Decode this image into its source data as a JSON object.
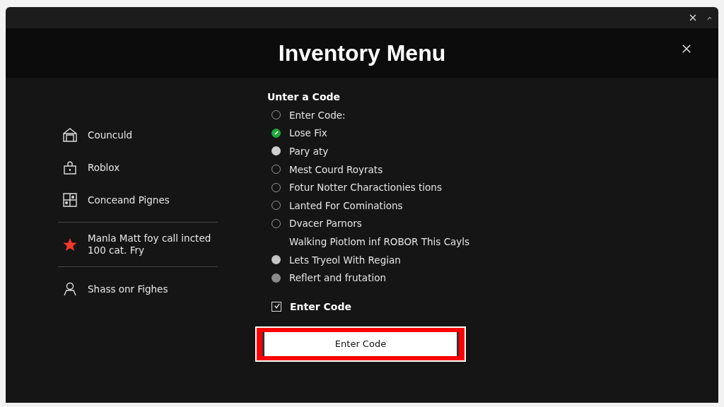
{
  "window": {
    "title": "Inventory Menu"
  },
  "sidebar": {
    "items": [
      {
        "label": "Counculd"
      },
      {
        "label": "Roblox"
      },
      {
        "label": "Conceand Pignes"
      },
      {
        "label": "Manla Matt foy call incted 100 cat. Fry"
      },
      {
        "label": "Shass onr Fighes"
      }
    ]
  },
  "form": {
    "heading": "Unter a Code",
    "options": [
      {
        "label": "Enter Code:",
        "kind": "radio",
        "selected": false
      },
      {
        "label": "Lose Fix",
        "kind": "radio",
        "selected": true
      },
      {
        "label": "Pary aty",
        "kind": "filled",
        "color": "#cfcfcf"
      },
      {
        "label": "Mest Courd Royrats",
        "kind": "radio",
        "selected": false
      },
      {
        "label": "Fotur Notter Charactionies tions",
        "kind": "radio",
        "selected": false
      },
      {
        "label": "Lanted For Cominations",
        "kind": "radio",
        "selected": false
      },
      {
        "label": "Dvacer Parnors",
        "kind": "radio",
        "selected": false
      },
      {
        "label": "Walking Piotlom inf ROBOR This Cayls",
        "kind": "plain"
      },
      {
        "label": "Lets Tryeol With Regian",
        "kind": "filled",
        "color": "#c4c4c4"
      },
      {
        "label": "Reflert and frutation",
        "kind": "filled",
        "color": "#8a8a8a"
      }
    ],
    "checkbox": {
      "label": "Enter Code",
      "checked": true
    },
    "button": "Enter Code"
  }
}
